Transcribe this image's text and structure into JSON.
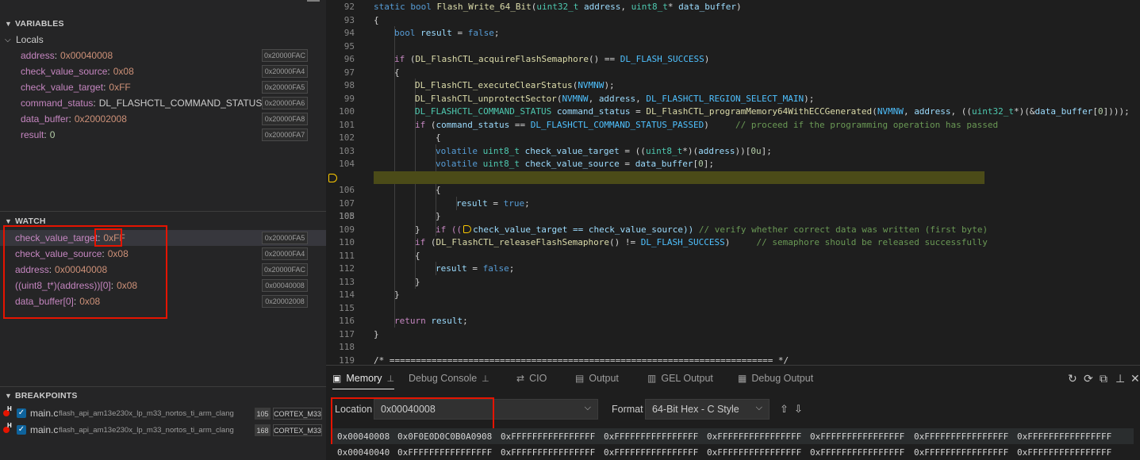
{
  "sidebar": {
    "variables_title": "VARIABLES",
    "locals_label": "Locals",
    "locals": [
      {
        "name": "address",
        "value": "0x00040008",
        "addr": "0x20000FAC"
      },
      {
        "name": "check_value_source",
        "value": "0x08",
        "addr": "0x20000FA4"
      },
      {
        "name": "check_value_target",
        "value": "0xFF",
        "addr": "0x20000FA5"
      },
      {
        "name": "command_status",
        "value": "DL_FLASHCTL_COMMAND_STATUS_P...",
        "addr": "0x20000FA6"
      },
      {
        "name": "data_buffer",
        "value": "0x20002008",
        "addr": "0x20000FA8"
      },
      {
        "name": "result",
        "value": "0",
        "addr": "0x20000FA7"
      }
    ],
    "watch_title": "WATCH",
    "watch": [
      {
        "name": "check_value_target",
        "value": "0xFF",
        "addr": "0x20000FA5"
      },
      {
        "name": "check_value_source",
        "value": "0x08",
        "addr": "0x20000FA4"
      },
      {
        "name": "address",
        "value": "0x00040008",
        "addr": "0x20000FAC"
      },
      {
        "name": "((uint8_t*)(address))[0]",
        "value": "0x08",
        "addr": "0x00040008"
      },
      {
        "name": "data_buffer[0]",
        "value": "0x08",
        "addr": "0x20002008"
      }
    ],
    "breakpoints_title": "BREAKPOINTS",
    "breakpoints": [
      {
        "file": "main.c",
        "path": "flash_api_am13e230x_lp_m33_nortos_ti_arm_clang",
        "line": "105",
        "core": "CORTEX_M33"
      },
      {
        "file": "main.c",
        "path": "flash_api_am13e230x_lp_m33_nortos_ti_arm_clang",
        "line": "168",
        "core": "CORTEX_M33"
      }
    ]
  },
  "editor": {
    "line_numbers": [
      "92",
      "93",
      "94",
      "95",
      "96",
      "97",
      "98",
      "99",
      "100",
      "101",
      "102",
      "103",
      "104",
      "105",
      "106",
      "107",
      "108",
      "109",
      "110",
      "111",
      "112",
      "113",
      "114",
      "115",
      "116",
      "117",
      "118",
      "119"
    ],
    "current_line": "105",
    "lines": {
      "92": [
        "static bool Flash_Write_64_Bit(uint32_t address, uint8_t* data_buffer)"
      ],
      "93": [
        "{"
      ],
      "94": [
        "bool result = false;"
      ],
      "96": [
        "if (DL_FlashCTL_acquireFlashSemaphore() == DL_FLASH_SUCCESS)"
      ],
      "97": [
        "{"
      ],
      "98": [
        "DL_FlashCTL_executeClearStatus(NVMNW);"
      ],
      "99": [
        "DL_FlashCTL_unprotectSector(NVMNW, address, DL_FLASHCTL_REGION_SELECT_MAIN);"
      ],
      "100": [
        "DL_FLASHCTL_COMMAND_STATUS command_status = DL_FlashCTL_programMemory64WithECCGenerated(NVMNW, address, ((uint32_t*)(&data_buffer[0])));"
      ],
      "101": [
        "if (command_status == DL_FLASHCTL_COMMAND_STATUS_PASSED)",
        "// proceed if the programming operation has passed"
      ],
      "102": [
        "{"
      ],
      "103": [
        "volatile uint8_t check_value_target = ((uint8_t*)(address))[0u];"
      ],
      "104": [
        "volatile uint8_t check_value_source = data_buffer[0];"
      ],
      "105": [
        "if ((",
        "check_value_target == check_value_source))",
        "// verify whether correct data was written (first byte)"
      ],
      "106": [
        "{"
      ],
      "107": [
        "result = true;"
      ],
      "108": [
        "}"
      ],
      "109": [
        "}"
      ],
      "110": [
        "if (DL_FlashCTL_releaseFlashSemaphore() != DL_FLASH_SUCCESS)",
        "// semaphore should be released successfully"
      ],
      "111": [
        "{"
      ],
      "112": [
        "result = false;"
      ],
      "113": [
        "}"
      ],
      "114": [
        "}"
      ],
      "116": [
        "return result;"
      ],
      "117": [
        "}"
      ],
      "119": [
        "/* ========================================================================= */"
      ]
    }
  },
  "panel": {
    "tabs": [
      "Memory",
      "Debug Console",
      "CIO",
      "Output",
      "GEL Output",
      "Debug Output"
    ],
    "active_tab": "Memory",
    "location_label": "Location",
    "location_value": "0x00040008",
    "format_label": "Format",
    "format_value": "64-Bit Hex - C Style",
    "rows": [
      {
        "addr": "0x00040008",
        "cells": [
          "0x0F0E0D0C0B0A0908",
          "0xFFFFFFFFFFFFFFFF",
          "0xFFFFFFFFFFFFFFFF",
          "0xFFFFFFFFFFFFFFFF",
          "0xFFFFFFFFFFFFFFFF",
          "0xFFFFFFFFFFFFFFFF",
          "0xFFFFFFFFFFFFFFFF"
        ]
      },
      {
        "addr": "0x00040040",
        "cells": [
          "0xFFFFFFFFFFFFFFFF",
          "0xFFFFFFFFFFFFFFFF",
          "0xFFFFFFFFFFFFFFFF",
          "0xFFFFFFFFFFFFFFFF",
          "0xFFFFFFFFFFFFFFFF",
          "0xFFFFFFFFFFFFFFFF",
          "0xFFFFFFFFFFFFFFFF"
        ]
      }
    ]
  },
  "colors": {
    "highlight_box": "#e51400",
    "current_line": "#4b4b18",
    "breakpoint": "#e51400"
  }
}
